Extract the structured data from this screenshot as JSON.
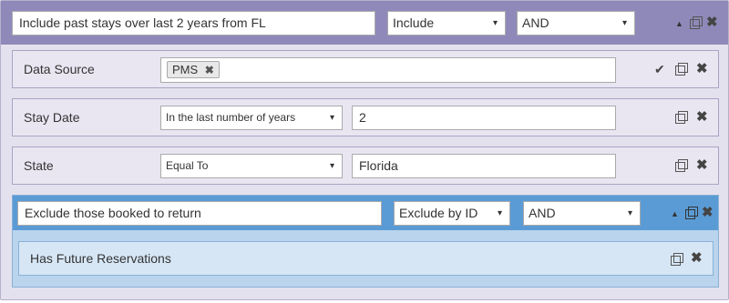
{
  "group": {
    "name_value": "Include past stays over last 2 years from FL",
    "mode_select": "Include",
    "logic_select": "AND"
  },
  "conditions": [
    {
      "label": "Data Source",
      "tag": "PMS"
    },
    {
      "label": "Stay Date",
      "operator": "In the last number of years",
      "value": "2"
    },
    {
      "label": "State",
      "operator": "Equal To",
      "value": "Florida"
    }
  ],
  "subgroup": {
    "name_value": "Exclude those booked to return",
    "mode_select": "Exclude by ID",
    "logic_select": "AND",
    "conditions": [
      {
        "label": "Has Future Reservations"
      }
    ]
  },
  "icons": {
    "caret": "▾",
    "up": "▲",
    "close": "✖",
    "check": "✔",
    "tag_remove": "✖"
  },
  "colors": {
    "group_header": "#8f89ba",
    "group_body": "#e4e1ee",
    "subgroup_header": "#5b9bd5",
    "subgroup_body": "#b9d4ec"
  }
}
